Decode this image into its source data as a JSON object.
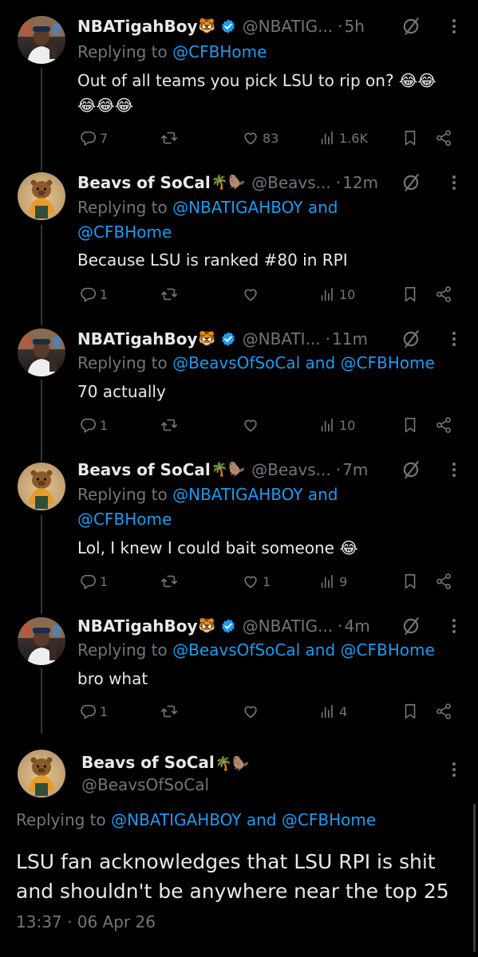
{
  "tweets": [
    {
      "name": "NBATigahBoy",
      "name_emoji": "🐯",
      "handle": "@NBATIG...",
      "time": "5h",
      "reply_prefix": "Replying to",
      "reply_to": "@CFBHome",
      "reply_and": "",
      "reply_to_2": "",
      "text_line1": "Out of all teams you pick LSU to rip on? 😂😂",
      "text_line2": "😂😂😂",
      "replies": "7",
      "reposts": "",
      "likes": "83",
      "views": "1.6K"
    },
    {
      "name": "Beavs of SoCal",
      "name_emoji": "🌴🦫",
      "handle": "@Beavs...",
      "time": "12m",
      "reply_prefix": "Replying to",
      "reply_to": "@NBATIGAHBOY",
      "reply_and": "and",
      "reply_to_2": "@CFBHome",
      "text_line1": "Because LSU is ranked #80 in RPI",
      "replies": "1",
      "likes": "",
      "views": "10"
    },
    {
      "name": "NBATigahBoy",
      "name_emoji": "🐯",
      "handle": "@NBATI...",
      "time": "11m",
      "reply_prefix": "Replying to",
      "reply_to": "@BeavsOfSoCal",
      "reply_and": "and",
      "reply_to_2": "@CFBHome",
      "text_line1": "70 actually",
      "replies": "1",
      "likes": "",
      "views": "10"
    },
    {
      "name": "Beavs of SoCal",
      "name_emoji": "🌴🦫",
      "handle": "@Beavs...",
      "time": "7m",
      "reply_prefix": "Replying to",
      "reply_to": "@NBATIGAHBOY",
      "reply_and": "and",
      "reply_to_2": "@CFBHome",
      "text_line1": "Lol, I knew I could bait someone 😂",
      "replies": "1",
      "likes": "1",
      "views": "9"
    },
    {
      "name": "NBATigahBoy",
      "name_emoji": "🐯",
      "handle": "@NBATIG...",
      "time": "4m",
      "reply_prefix": "Replying to",
      "reply_to": "@BeavsOfSoCal",
      "reply_and": "and",
      "reply_to_2": "@CFBHome",
      "text_line1": "bro what",
      "replies": "1",
      "likes": "",
      "views": "4"
    }
  ],
  "main": {
    "name": "Beavs of SoCal",
    "name_emoji": "🌴🦫",
    "handle": "@BeavsOfSoCal",
    "reply_prefix": "Replying to",
    "reply_to": "@NBATIGAHBOY",
    "reply_and": "and",
    "reply_to_2": "@CFBHome",
    "text_line1": "LSU fan acknowledges that LSU RPI is shit",
    "text_line2": "and shouldn't be anywhere near the top 25",
    "time": "13:37",
    "date": "06 Apr 26"
  },
  "colors": {
    "background": "#000000",
    "text": "#e7e9ea",
    "muted": "#71767b",
    "accent": "#1d9bf0",
    "divider": "#2f3336"
  },
  "icons": {
    "verified": "verified-badge-icon",
    "grok": "grok-icon",
    "more": "more-icon",
    "reply": "reply-icon",
    "repost": "repost-icon",
    "like": "like-icon",
    "views": "views-icon",
    "bookmark": "bookmark-icon",
    "share": "share-icon"
  }
}
